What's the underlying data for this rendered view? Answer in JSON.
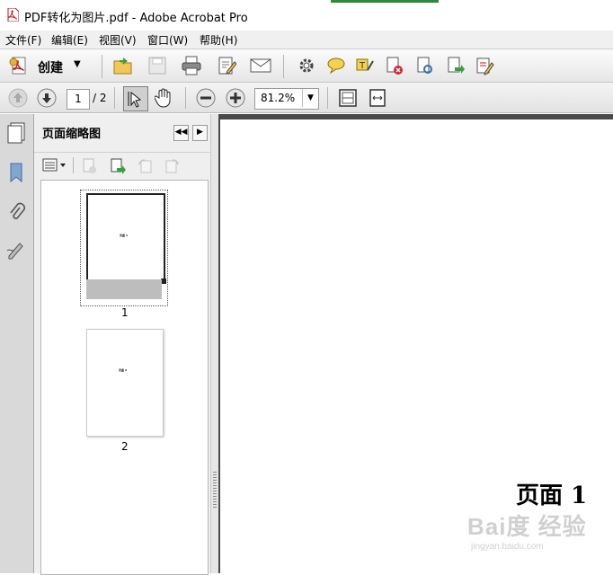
{
  "window": {
    "title": "PDF转化为图片.pdf - Adobe Acrobat Pro"
  },
  "menu": [
    "文件(F)",
    "编辑(E)",
    "视图(V)",
    "窗口(W)",
    "帮助(H)"
  ],
  "toolbar": {
    "create_label": "创建"
  },
  "navigation": {
    "current_page": "1",
    "total_pages": "/ 2",
    "zoom": "81.2%"
  },
  "panel": {
    "title": "页面缩略图"
  },
  "thumbnails": [
    {
      "number": "1",
      "text": "页面 1"
    },
    {
      "number": "2",
      "text": "页面 2"
    }
  ],
  "document": {
    "page_label": "页面 1"
  },
  "watermark": {
    "brand": "Bai度 经验",
    "url": "jingyan.baidu.com"
  },
  "colors": {
    "accent": "#2f6fb6",
    "pdf_red": "#c8141e"
  }
}
